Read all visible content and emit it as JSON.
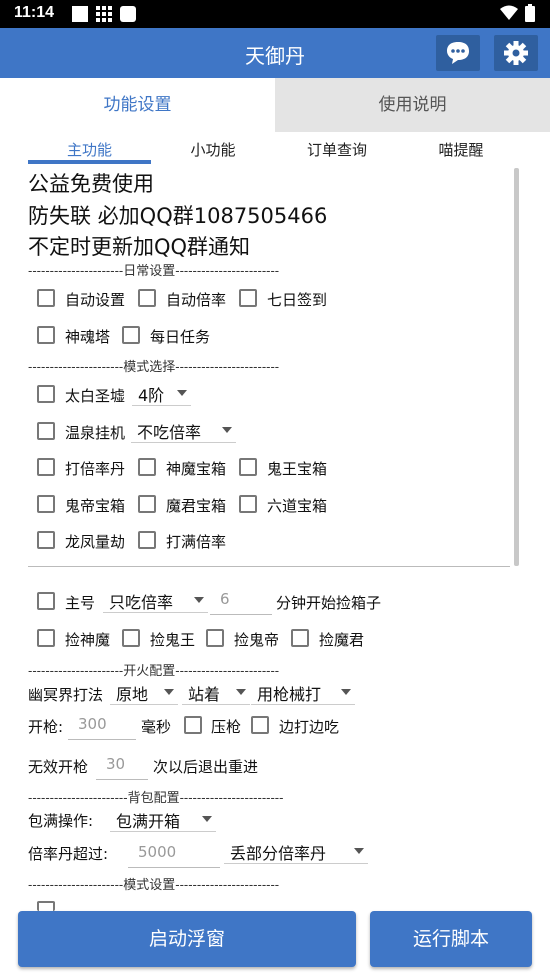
{
  "status": {
    "time": "11:14"
  },
  "app": {
    "title": "天御丹",
    "accent": "#3f76c6"
  },
  "tabs": [
    "功能设置",
    "使用说明"
  ],
  "subtabs": [
    "主功能",
    "小功能",
    "订单查询",
    "喵提醒"
  ],
  "notice": [
    "公益免费使用",
    "防失联 必加QQ群1087505466",
    "不定时更新加QQ群通知"
  ],
  "sections": {
    "daily": "----------------------日常设置------------------------",
    "mode": "----------------------模式选择------------------------",
    "fire": "----------------------开火配置------------------------",
    "bag": "-----------------------背包配置------------------------",
    "mode2": "----------------------模式设置------------------------"
  },
  "checks": {
    "auto_set": "自动设置",
    "auto_rate": "自动倍率",
    "seven_day": "七日签到",
    "soul_tower": "神魂塔",
    "daily_task": "每日任务",
    "taibai": "太白圣墟",
    "hot_spring": "温泉挂机",
    "beat_pill": "打倍率丹",
    "god_demon_box": "神魔宝箱",
    "ghost_king_box": "鬼王宝箱",
    "ghost_emperor_box": "鬼帝宝箱",
    "demon_lord_box": "魔君宝箱",
    "six_path_box": "六道宝箱",
    "dragon_phoenix": "龙凤量劫",
    "full_rate": "打满倍率",
    "main_account": "主号",
    "pick_god_demon": "捡神魔",
    "pick_ghost_king": "捡鬼王",
    "pick_ghost_emperor": "捡鬼帝",
    "pick_demon_lord": "捡魔君",
    "press_gun": "压枪",
    "fight_eat": "边打边吃"
  },
  "selects": {
    "taibai_level": "4阶",
    "hot_spring_mode": "不吃倍率",
    "main_mode": "只吃倍率",
    "stance1": "原地",
    "stance2": "站着",
    "weapon": "用枪械打",
    "bag_op": "包满开箱",
    "drop_mode": "丢部分倍率丹"
  },
  "inputs": {
    "minutes": "6",
    "fire_ms": "300",
    "invalid_count": "30",
    "pill_limit": "5000"
  },
  "labels": {
    "minutes_suffix": "分钟开始捡箱子",
    "netherworld": "幽冥界打法",
    "fire": "开枪:",
    "ms": "毫秒",
    "invalid_prefix": "无效开枪",
    "invalid_suffix": "次以后退出重进",
    "bag_op": "包满操作:",
    "pill_over": "倍率丹超过:"
  },
  "buttons": {
    "float": "启动浮窗",
    "run": "运行脚本"
  }
}
